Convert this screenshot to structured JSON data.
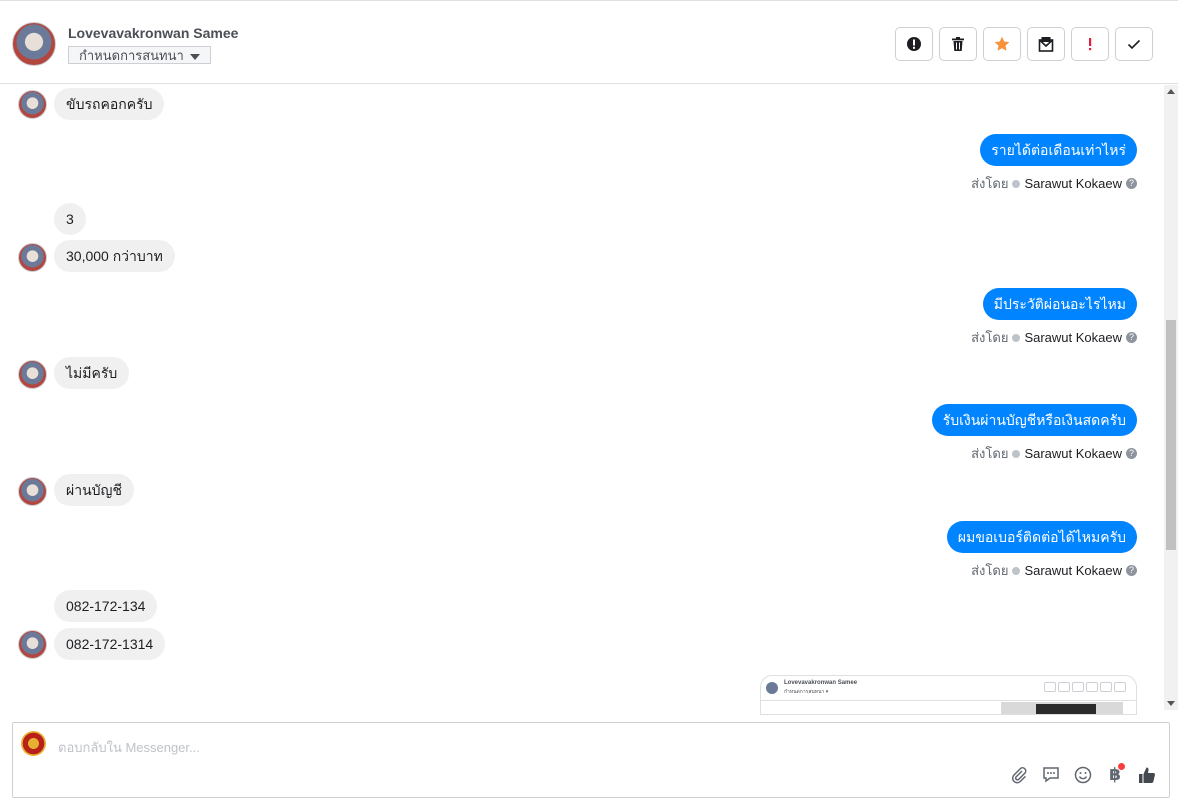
{
  "header": {
    "contact_name": "Lovevavakronwan Samee",
    "conversation_settings_label": "กำหนดการสนทนา",
    "actions": [
      {
        "icon": "alert-circle-icon",
        "color": "#1c1e21"
      },
      {
        "icon": "trash-icon",
        "color": "#1c1e21"
      },
      {
        "icon": "star-icon",
        "color": "#f7923b"
      },
      {
        "icon": "mark-unread-icon",
        "color": "#1c1e21"
      },
      {
        "icon": "exclamation-icon",
        "color": "#e41e3f"
      },
      {
        "icon": "check-icon",
        "color": "#1c1e21"
      }
    ]
  },
  "thread": {
    "messages": [
      {
        "direction": "in",
        "text": "ขับรถคอกครับ"
      },
      {
        "direction": "out",
        "text": "รายได้ต่อเดือนเท่าไหร่"
      },
      {
        "direction": "in",
        "text": "3"
      },
      {
        "direction": "in",
        "text": "30,000 กว่าบาท"
      },
      {
        "direction": "out",
        "text": "มีประวัติผ่อนอะไรไหม"
      },
      {
        "direction": "in",
        "text": "ไม่มีครับ"
      },
      {
        "direction": "out",
        "text": "รับเงินผ่านบัญชีหรือเงินสดครับ"
      },
      {
        "direction": "in",
        "text": "ผ่านบัญชี"
      },
      {
        "direction": "out",
        "text": "ผมขอเบอร์ติดต่อได้ไหมครับ"
      },
      {
        "direction": "in",
        "text": "082-172-134"
      },
      {
        "direction": "in",
        "text": "082-172-1314"
      }
    ],
    "sent_by_label": "ส่งโดย",
    "sent_by_name": "Sarawut Kokaew",
    "attachment_preview": {
      "mini_name": "Lovevavakronwan Samee",
      "mini_sub": "กำหนดการสนทนา ▾"
    }
  },
  "composer": {
    "placeholder": "ตอบกลับใน Messenger...",
    "tools": [
      "paperclip-icon",
      "saved-reply-icon",
      "emoji-icon",
      "baht-payment-icon",
      "thumbs-up-icon"
    ],
    "baht_symbol": "฿"
  },
  "colors": {
    "accent_blue": "#0084ff",
    "incoming_bubble": "#f1f0f0",
    "star_orange": "#f7923b",
    "alert_red": "#e41e3f"
  }
}
